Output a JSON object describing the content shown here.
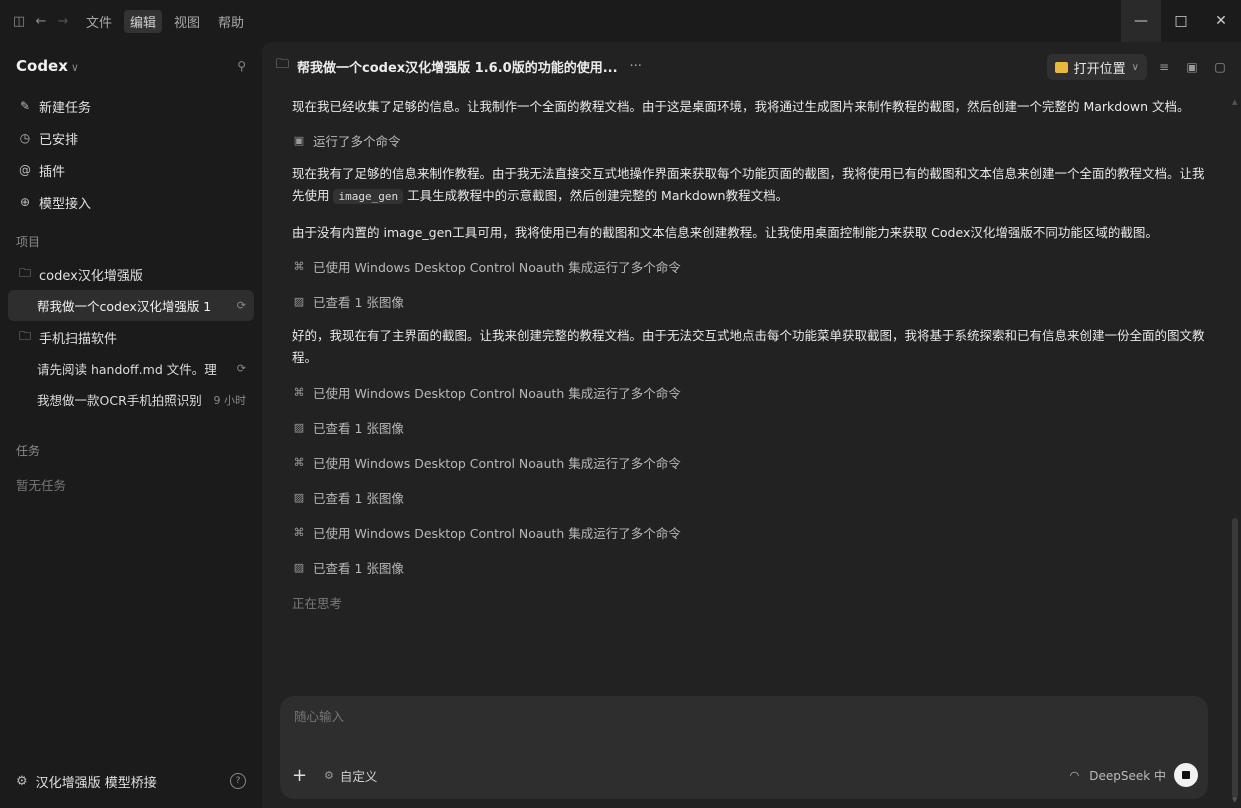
{
  "titlebar": {
    "menu": [
      "文件",
      "编辑",
      "视图",
      "帮助"
    ],
    "active_menu_index": 1
  },
  "sidebar": {
    "app_name": "Codex",
    "nav": [
      {
        "icon": "edit-icon",
        "label": "新建任务"
      },
      {
        "icon": "clock-icon",
        "label": "已安排"
      },
      {
        "icon": "plugin-icon",
        "label": "插件"
      },
      {
        "icon": "plus-circle-icon",
        "label": "模型接入"
      }
    ],
    "projects_header": "项目",
    "projects": [
      {
        "name": "codex汉化增强版",
        "threads": [
          {
            "title": "帮我做一个codex汉化增强版 1",
            "meta": "",
            "selected": true
          }
        ]
      },
      {
        "name": "手机扫描软件",
        "threads": [
          {
            "title": "请先阅读 handoff.md 文件。理",
            "meta": "",
            "selected": false
          },
          {
            "title": "我想做一款OCR手机拍照识别",
            "meta": "9 小时",
            "selected": false
          }
        ]
      }
    ],
    "tasks_header": "任务",
    "tasks_empty": "暂无任务",
    "footer_label": "汉化增强版 模型桥接"
  },
  "main": {
    "title": "帮我做一个codex汉化增强版 1.6.0版的功能的使用...",
    "title_more": "···",
    "open_location_label": "打开位置",
    "content": [
      {
        "type": "para",
        "text": "现在我已经收集了足够的信息。让我制作一个全面的教程文档。由于这是桌面环境，我将通过生成图片来制作教程的截图，然后创建一个完整的 Markdown 文档。"
      },
      {
        "type": "status",
        "icon": "terminal-icon",
        "text": "运行了多个命令"
      },
      {
        "type": "para_code",
        "pre": "现在我有了足够的信息来制作教程。由于我无法直接交互式地操作界面来获取每个功能页面的截图，我将使用已有的截图和文本信息来创建一个全面的教程文档。让我先使用 ",
        "code": "image_gen",
        "post": " 工具生成教程中的示意截图，然后创建完整的 Markdown教程文档。"
      },
      {
        "type": "para",
        "text": "由于没有内置的 image_gen工具可用，我将使用已有的截图和文本信息来创建教程。让我使用桌面控制能力来获取 Codex汉化增强版不同功能区域的截图。"
      },
      {
        "type": "status",
        "icon": "command-icon",
        "text": "已使用 Windows Desktop Control Noauth 集成运行了多个命令"
      },
      {
        "type": "status",
        "icon": "image-icon",
        "text": "已查看 1 张图像"
      },
      {
        "type": "para",
        "text": "好的，我现在有了主界面的截图。让我来创建完整的教程文档。由于无法交互式地点击每个功能菜单获取截图，我将基于系统探索和已有信息来创建一份全面的图文教程。"
      },
      {
        "type": "status",
        "icon": "command-icon",
        "text": "已使用 Windows Desktop Control Noauth 集成运行了多个命令"
      },
      {
        "type": "status",
        "icon": "image-icon",
        "text": "已查看 1 张图像"
      },
      {
        "type": "status",
        "icon": "command-icon",
        "text": "已使用 Windows Desktop Control Noauth 集成运行了多个命令"
      },
      {
        "type": "status",
        "icon": "image-icon",
        "text": "已查看 1 张图像"
      },
      {
        "type": "status",
        "icon": "command-icon",
        "text": "已使用 Windows Desktop Control Noauth 集成运行了多个命令"
      },
      {
        "type": "status",
        "icon": "image-icon",
        "text": "已查看 1 张图像"
      },
      {
        "type": "thinking",
        "text": "正在思考"
      }
    ],
    "composer": {
      "placeholder": "随心输入",
      "custom_label": "自定义",
      "model_label": "DeepSeek 中"
    }
  }
}
